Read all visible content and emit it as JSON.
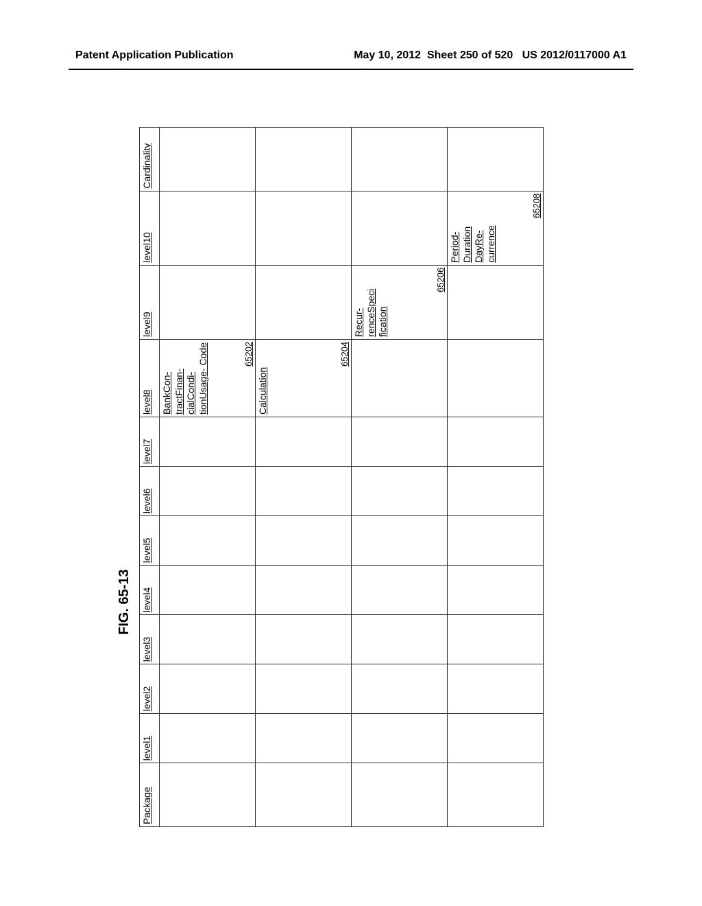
{
  "header": {
    "left": "Patent Application Publication",
    "date": "May 10, 2012",
    "sheet": "Sheet 250 of 520",
    "pubno": "US 2012/0117000 A1"
  },
  "figure_title": "FIG. 65-13",
  "columns": [
    "Package",
    "level1",
    "level2",
    "level3",
    "level4",
    "level5",
    "level6",
    "level7",
    "level8",
    "level9",
    "level10",
    "Cardinality"
  ],
  "rows": [
    {
      "level8": {
        "term": "BankCon-\ntractFinan-\ncialCondi-\ntionUsage-\nCode",
        "ref": "65202"
      }
    },
    {
      "level8": {
        "term": "Calculation",
        "ref": "65204"
      }
    },
    {
      "level9": {
        "term": "Recur-\nrenceSpeci\nfication",
        "ref": "65206"
      }
    },
    {
      "level10": {
        "term": "Period-\nDuration\nDayRe-\ncurrence",
        "ref": "65208"
      }
    }
  ]
}
